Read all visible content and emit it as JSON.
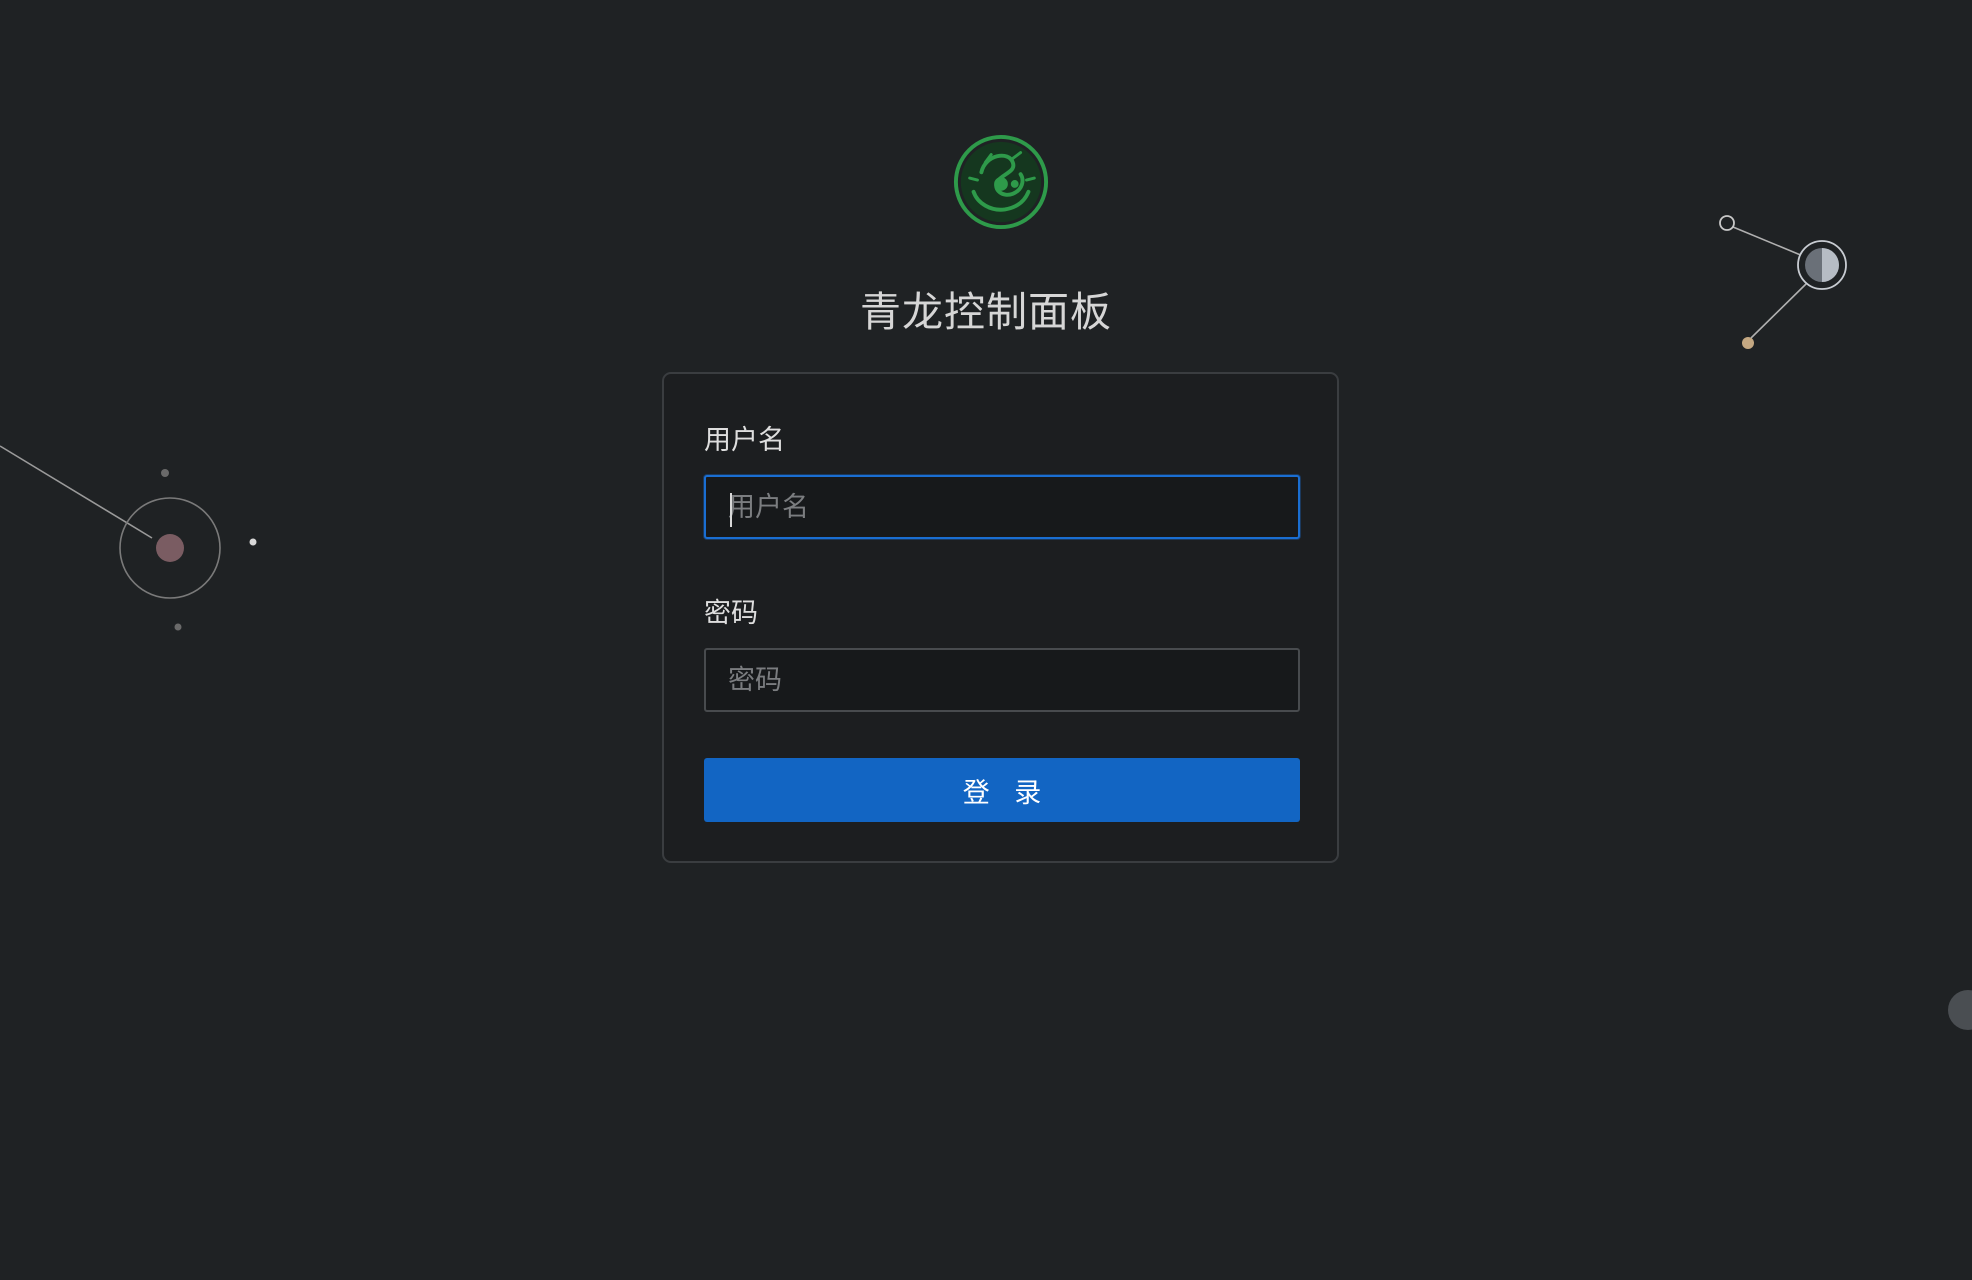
{
  "app": {
    "title": "青龙控制面板"
  },
  "login_form": {
    "username_label": "用户名",
    "username_placeholder": "用户名",
    "username_value": "",
    "password_label": "密码",
    "password_placeholder": "密码",
    "password_value": "",
    "submit_label": "登 录"
  },
  "colors": {
    "background": "#1f2224",
    "card_background": "#1c1e20",
    "primary": "#1265c3",
    "focus_border": "#1a6ed2",
    "logo_green": "#2e9a4a"
  },
  "icons": {
    "logo": "qinglong-dragon-logo"
  }
}
